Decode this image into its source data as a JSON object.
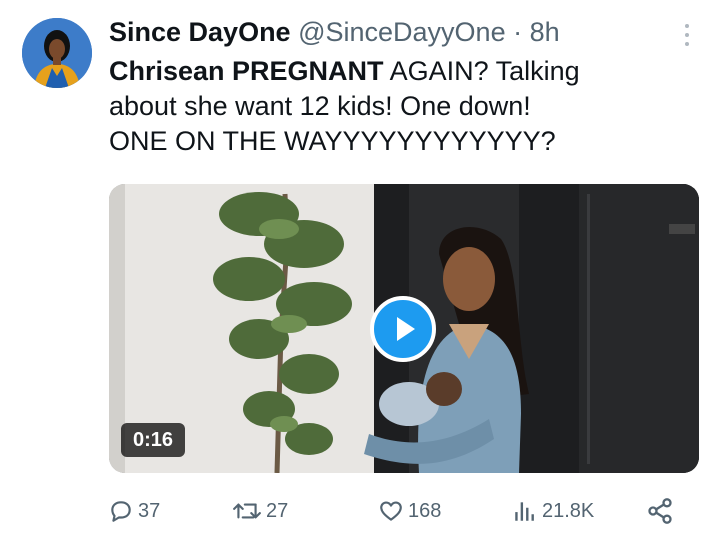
{
  "tweet": {
    "display_name": "Since DayOne",
    "handle": "@SinceDayyOne",
    "separator": "·",
    "time": "8h",
    "text_bold": "Chrisean PREGNANT",
    "text_rest_line1": " AGAIN? Talking",
    "text_line2": "about she want 12 kids! One down!",
    "text_line3": "ONE ON THE WAYYYYYYYYYYYY?"
  },
  "media": {
    "duration": "0:16"
  },
  "actions": {
    "replies": "37",
    "retweets": "27",
    "likes": "168",
    "views": "21.8K"
  },
  "icons": {
    "reply": "reply-icon",
    "retweet": "retweet-icon",
    "like": "heart-icon",
    "views": "views-icon",
    "share": "share-icon",
    "more": "more-icon",
    "play": "play-icon"
  },
  "colors": {
    "accent": "#1d9bf0",
    "secondary_text": "#536471",
    "primary_text": "#0f1419"
  }
}
